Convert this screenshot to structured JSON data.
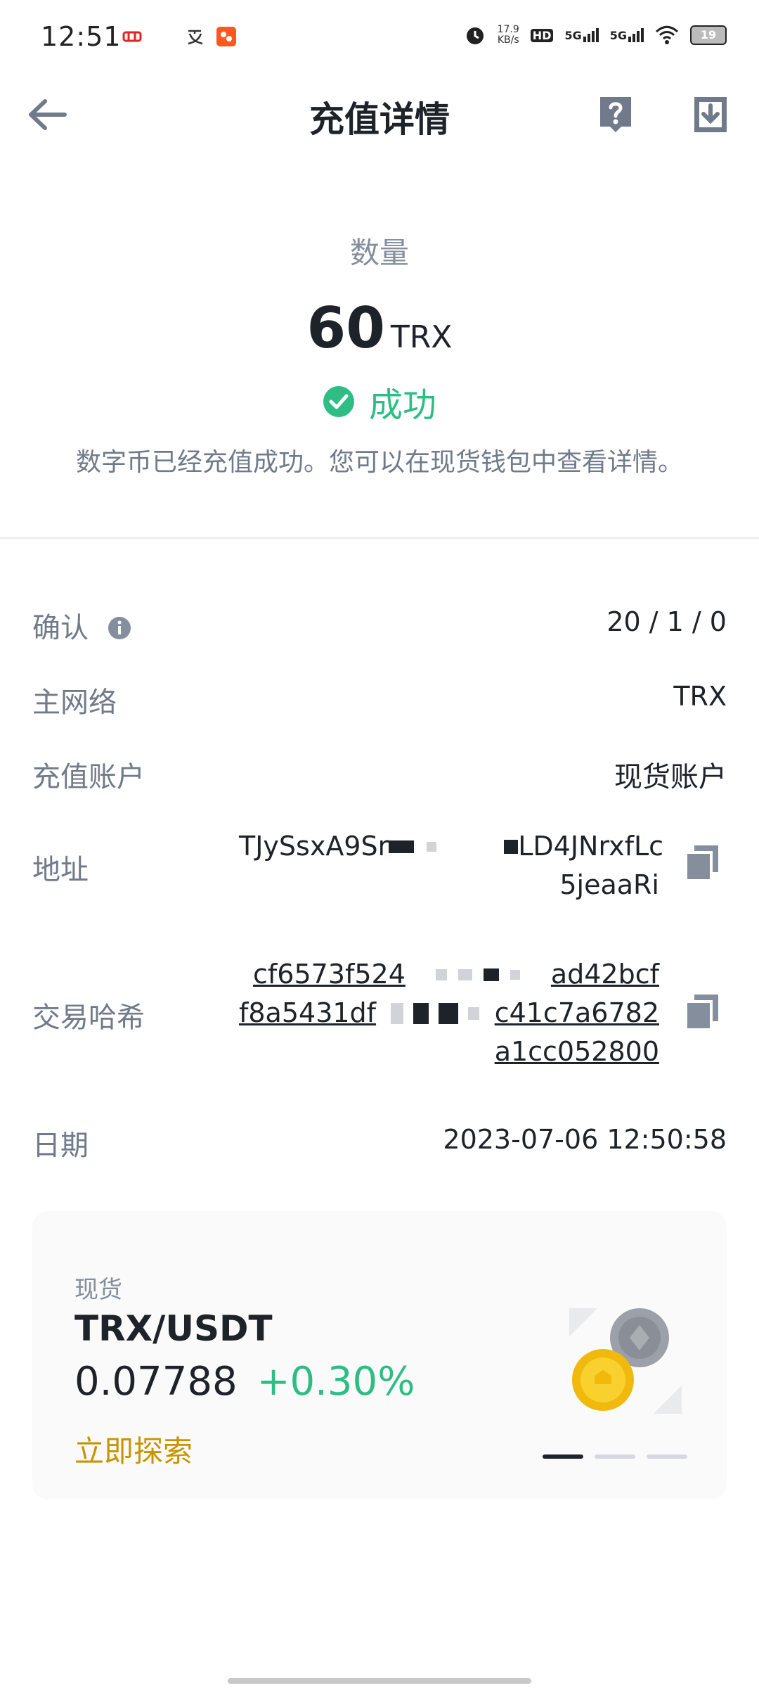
{
  "status_bar": {
    "time": "12:51",
    "net_speed": "17.9",
    "net_unit": "KB/s",
    "hd_label": "HD",
    "sim1": "5G",
    "sim2": "5G",
    "battery": "19"
  },
  "header": {
    "title": "充值详情"
  },
  "summary": {
    "quantity_label": "数量",
    "amount": "60",
    "unit": "TRX",
    "status": "成功",
    "description": "数字币已经充值成功。您可以在现货钱包中查看详情。"
  },
  "details": {
    "confirm_label": "确认",
    "confirm_value": "20 / 1 / 0",
    "network_label": "主网络",
    "network_value": "TRX",
    "account_label": "充值账户",
    "account_value": "现货账户",
    "address_label": "地址",
    "address_line1_a": "TJySsxA9Sr",
    "address_line1_b": "LD4JNrxfLc",
    "address_line2": "5jeaaRi",
    "txhash_label": "交易哈希",
    "txhash_line1_a": "cf6573f524",
    "txhash_line1_b": "ad42bcf",
    "txhash_line2_a": "f8a5431df",
    "txhash_line2_b": "c41c7a6782",
    "txhash_line3": "a1cc052800",
    "date_label": "日期",
    "date_value": "2023-07-06 12:50:58"
  },
  "promo": {
    "tag": "现货",
    "pair": "TRX/USDT",
    "price": "0.07788",
    "change": "+0.30%",
    "cta": "立即探索"
  },
  "colors": {
    "success": "#2ebd85",
    "accent": "#c99400",
    "text_primary": "#1e2329",
    "text_secondary": "#707a8a"
  }
}
